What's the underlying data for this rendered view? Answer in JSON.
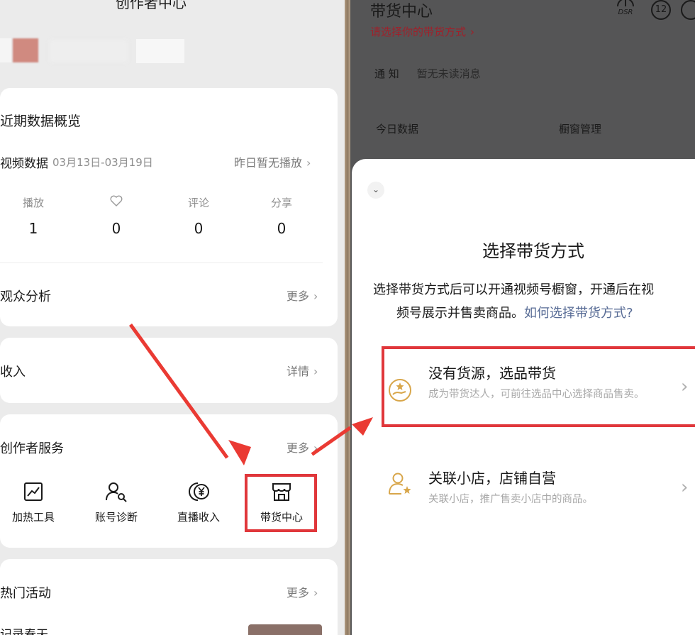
{
  "left": {
    "header_title": "创作者中心",
    "overview_title": "近期数据概览",
    "video_label": "视频数据",
    "date_range": "03月13日-03月19日",
    "no_play": "昨日暂无播放",
    "stats": [
      {
        "label": "播放",
        "value": "1"
      },
      {
        "label": "",
        "value": "0"
      },
      {
        "label": "评论",
        "value": "0"
      },
      {
        "label": "分享",
        "value": "0"
      }
    ],
    "audience_title": "观众分析",
    "audience_more": "更多",
    "income_title": "收入",
    "income_more": "详情",
    "services_title": "创作者服务",
    "services_more": "更多",
    "services": [
      {
        "label": "加热工具",
        "icon": "chart-up-icon"
      },
      {
        "label": "账号诊断",
        "icon": "user-search-icon"
      },
      {
        "label": "直播收入",
        "icon": "yen-coin-icon"
      },
      {
        "label": "带货中心",
        "icon": "store-icon"
      }
    ],
    "hot_title": "热门活动",
    "hot_more": "更多",
    "hot_item": "记录春天"
  },
  "right": {
    "title": "带货中心",
    "subtitle": "请选择你的带货方式",
    "badge_dsr": "DSR",
    "badge_num": "12",
    "notice_label": "通 知",
    "notice_text": "暂无未读消息",
    "today_data": "今日数据",
    "window_manage": "橱窗管理",
    "sheet_title": "选择带货方式",
    "sheet_desc_line1": "选择带货方式后可以开通视频号橱窗，开通后在视",
    "sheet_desc_line2_a": "频号展示并售卖商品。",
    "sheet_desc_link": "如何选择带货方式?",
    "options": [
      {
        "title": "没有货源，选品带货",
        "desc": "成为带货达人，可前往选品中心选择商品售卖。",
        "icon": "hand-star-icon"
      },
      {
        "title": "关联小店，店铺自营",
        "desc": "关联小店，推广售卖小店中的商品。",
        "icon": "user-star-icon"
      }
    ]
  },
  "colors": {
    "accent_red": "#e0373b",
    "link_blue": "#576b95",
    "icon_gold": "#d8a64a"
  }
}
